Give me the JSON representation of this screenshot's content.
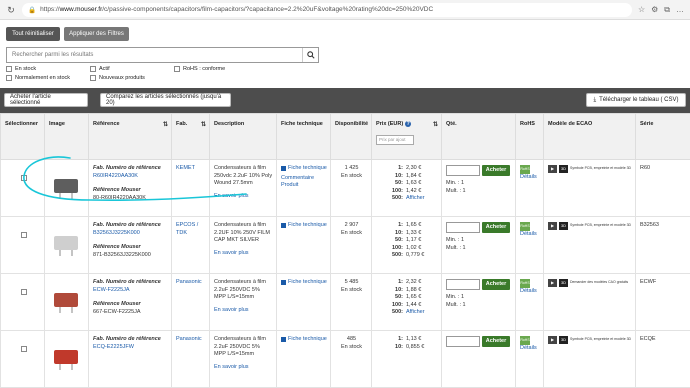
{
  "browser": {
    "url_prefix": "https://",
    "url_host": "www.mouser.fr",
    "url_path": "/c/passive-components/capacitors/film-capacitors/?capacitance=2.2%20uF&voltage%20rating%20dc=250%20VDC"
  },
  "actions": {
    "reset": "Tout réinitialiser",
    "apply": "Appliquer des Filtres"
  },
  "search": {
    "placeholder": "Rechercher parmi les résultats"
  },
  "filters": {
    "in_stock": "En stock",
    "normally_in_stock": "Normalement en stock",
    "active": "Actif",
    "new_products": "Nouveaux produits",
    "rohs": "RoHS : conforme"
  },
  "toolbar": {
    "buy_selected": "Acheter l'article sélectionné",
    "compare": "Comparez les articles sélectionnés (jusqu'à 20)",
    "download": "Télécharger le tableau ( CSV)"
  },
  "columns": {
    "select": "Sélectionner",
    "image": "Image",
    "reference": "Référence",
    "manufacturer": "Fab.",
    "description": "Description",
    "datasheet": "Fiche technique",
    "availability": "Disponibilité",
    "price": "Prix (EUR)",
    "price_placeholder": "Prix par ajout",
    "qty": "Qté.",
    "rohs": "RoHS",
    "ecad": "Modèle de ECAO",
    "series": "Série"
  },
  "labels": {
    "mfr_ref": "Fab. Numéro de référence",
    "mouser_ref": "Référence Mouser",
    "learn_more": "En savoir plus",
    "datasheet": "Fiche technique",
    "comment": "Commentaire Produit",
    "buy": "Acheter",
    "details": "Détails",
    "in_stock": "En stock",
    "show": "Afficher",
    "min": "Min. :",
    "mult": "Mult. :",
    "ecad_symbol": "Symbole PCB, empreinte et modèle 3D",
    "ecad_request": "Demander des modèles CAO gratuits"
  },
  "rows": [
    {
      "mfr_pn": "R60IR4220AA30K",
      "mouser_pn": "80-R60IR4220AA30K",
      "mfr": "KEMET",
      "desc": "Condensateurs à film 250vdc 2.2uF 10% Poly Wound 27.5mm",
      "stock": "1 425",
      "prices": [
        [
          "1:",
          "2,30 €"
        ],
        [
          "10:",
          "1,84 €"
        ],
        [
          "50:",
          "1,63 €"
        ],
        [
          "100:",
          "1,42 €"
        ],
        [
          "500:",
          "Afficher"
        ]
      ],
      "min": "1",
      "mult": "1",
      "series": "R60"
    },
    {
      "mfr_pn": "B32563J3225K000",
      "mouser_pn": "871-B32563J3225K000",
      "mfr": "EPCOS / TDK",
      "desc": "Condensateurs à film 2.2UF 10% 250V FILM CAP MKT SILVER",
      "stock": "2 907",
      "prices": [
        [
          "1:",
          "1,65 €"
        ],
        [
          "10:",
          "1,33 €"
        ],
        [
          "50:",
          "1,17 €"
        ],
        [
          "100:",
          "1,02 €"
        ],
        [
          "500:",
          "0,779 €"
        ]
      ],
      "min": "1",
      "mult": "1",
      "series": "B32563"
    },
    {
      "mfr_pn": "ECW-F2225JA",
      "mouser_pn": "667-ECW-F2225JA",
      "mfr": "Panasonic",
      "desc": "Condensateurs à film 2.2uF 250VDC 5% MPP L/S=15mm",
      "stock": "5 485",
      "prices": [
        [
          "1:",
          "2,32 €"
        ],
        [
          "10:",
          "1,88 €"
        ],
        [
          "50:",
          "1,65 €"
        ],
        [
          "100:",
          "1,44 €"
        ],
        [
          "500:",
          "Afficher"
        ]
      ],
      "min": "1",
      "mult": "1",
      "series": "ECWF"
    },
    {
      "mfr_pn": "ECQ-E2225JFW",
      "mouser_pn": "",
      "mfr": "Panasonic",
      "desc": "Condensateurs à film 2.2uF 250VDC 5% MPP L/S=15mm",
      "stock": "485",
      "prices": [
        [
          "1:",
          "1,13 €"
        ],
        [
          "10:",
          "0,855 €"
        ]
      ],
      "min": "",
      "mult": "",
      "series": "ECQE"
    }
  ],
  "colors": {
    "highlight": "#19c6d8",
    "buy_button": "#3a7a2a",
    "link": "#1a5aa8",
    "toolbar_bg": "#4d4d4d"
  }
}
